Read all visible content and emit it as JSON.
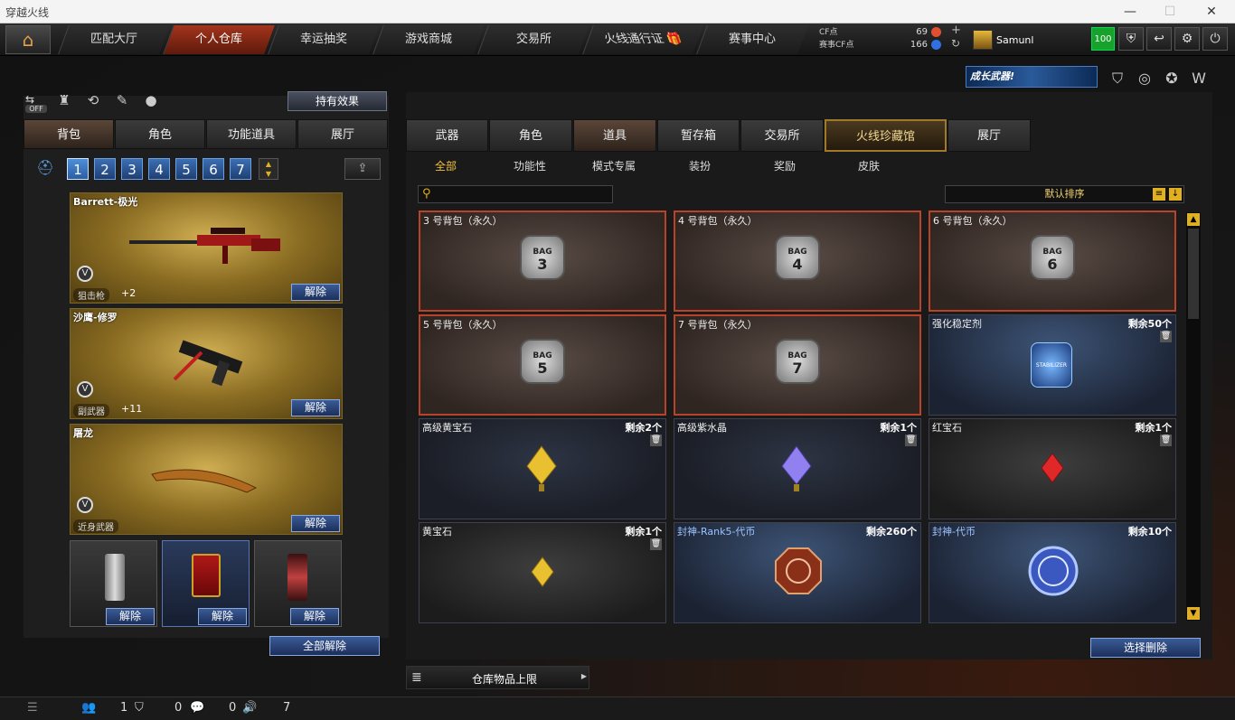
{
  "window": {
    "title": "穿越火线"
  },
  "nav": {
    "tabs": [
      {
        "label": "匹配大厅"
      },
      {
        "label": "个人仓库"
      },
      {
        "label": "幸运抽奖"
      },
      {
        "label": "游戏商城"
      },
      {
        "label": "交易所"
      },
      {
        "label": "火线通行证"
      },
      {
        "label": "赛事中心"
      }
    ],
    "cf_label": "CF点",
    "cf_value": "69",
    "event_cf_label": "赛事CF点",
    "event_cf_value": "166",
    "username": "Samunl",
    "level": "100"
  },
  "banner": {
    "text": "成长武器!"
  },
  "left": {
    "effect_button": "持有效果",
    "off_label": "OFF",
    "tabs": [
      {
        "label": "背包"
      },
      {
        "label": "角色"
      },
      {
        "label": "功能道具"
      },
      {
        "label": "展厅"
      }
    ],
    "bag_numbers": [
      "1",
      "2",
      "3",
      "4",
      "5",
      "6",
      "7"
    ],
    "weapons": [
      {
        "name": "Barrett-极光",
        "type": "狙击枪",
        "level": "+2",
        "remove": "解除"
      },
      {
        "name": "沙鹰-修罗",
        "type": "副武器",
        "level": "+11",
        "remove": "解除"
      },
      {
        "name": "屠龙",
        "type": "近身武器",
        "level": "",
        "remove": "解除"
      }
    ],
    "small_slots": [
      {
        "remove": "解除"
      },
      {
        "remove": "解除"
      },
      {
        "remove": "解除"
      }
    ],
    "remove_all": "全部解除"
  },
  "right": {
    "tabs": [
      {
        "label": "武器"
      },
      {
        "label": "角色"
      },
      {
        "label": "道具"
      },
      {
        "label": "暂存箱"
      },
      {
        "label": "交易所"
      },
      {
        "label": "火线珍藏馆"
      },
      {
        "label": "展厅"
      }
    ],
    "subtabs": [
      {
        "label": "全部"
      },
      {
        "label": "功能性"
      },
      {
        "label": "模式专属"
      },
      {
        "label": "装扮"
      },
      {
        "label": "奖励"
      },
      {
        "label": "皮肤"
      }
    ],
    "search_placeholder": "",
    "sort_label": "默认排序",
    "items": [
      {
        "name": "3 号背包（永久）",
        "count": "",
        "bag": "BAG",
        "bagnum": "3"
      },
      {
        "name": "4 号背包（永久）",
        "count": "",
        "bag": "BAG",
        "bagnum": "4"
      },
      {
        "name": "6 号背包（永久）",
        "count": "",
        "bag": "BAG",
        "bagnum": "6"
      },
      {
        "name": "5 号背包（永久）",
        "count": "",
        "bag": "BAG",
        "bagnum": "5"
      },
      {
        "name": "7 号背包（永久）",
        "count": "",
        "bag": "BAG",
        "bagnum": "7"
      },
      {
        "name": "强化稳定剂",
        "count": "剩余50个",
        "label": "STABILIZER"
      },
      {
        "name": "高级黄宝石",
        "count": "剩余2个"
      },
      {
        "name": "高级紫水晶",
        "count": "剩余1个"
      },
      {
        "name": "红宝石",
        "count": "剩余1个"
      },
      {
        "name": "黄宝石",
        "count": "剩余1个"
      },
      {
        "name": "封神-Rank5-代币",
        "count": "剩余260个"
      },
      {
        "name": "封神-代币",
        "count": "剩余10个"
      }
    ],
    "delete_selected": "选择删除",
    "capacity_label": "仓库物品上限"
  },
  "status": {
    "v1": "1",
    "v2": "0",
    "v3": "0",
    "v4": "7"
  }
}
